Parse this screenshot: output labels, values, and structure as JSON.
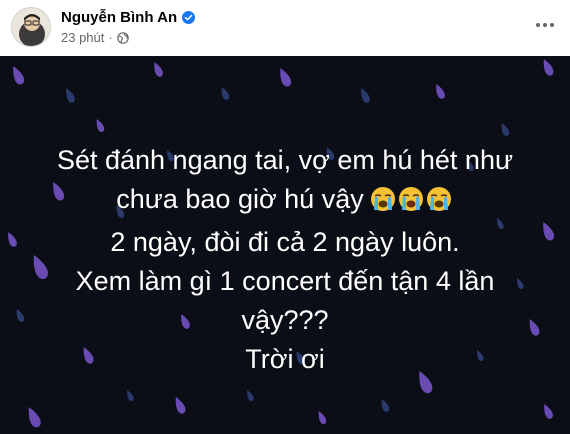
{
  "post": {
    "author": "Nguyễn Bình An",
    "timestamp": "23 phút",
    "separator": "·",
    "privacy_icon": "globe-icon",
    "verified_icon": "verified-badge-icon",
    "more_icon": "more-options-icon",
    "text_lines": [
      "Sét đánh ngang tai, vợ em hú hét như",
      "chưa bao giờ hú vậy",
      "2 ngày, đòi đi cả 2 ngày luôn.",
      "Xem làm gì 1 concert đến tận 4 lần",
      "vậy???",
      "Trời ơi"
    ],
    "emoji": [
      "loudly-crying-face",
      "loudly-crying-face",
      "loudly-crying-face"
    ]
  },
  "colors": {
    "background": "#0b0e16",
    "drop_purple": "#6a4bb3",
    "drop_blue": "#2a3a6b",
    "verified": "#1877f2",
    "meta": "#65676b"
  }
}
